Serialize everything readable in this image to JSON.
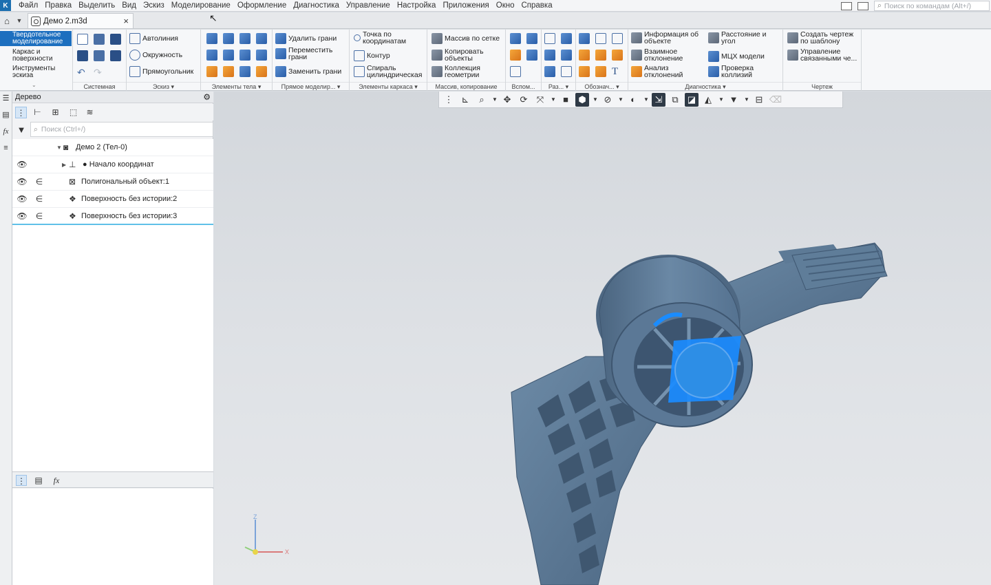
{
  "menubar": {
    "items": [
      "Файл",
      "Правка",
      "Выделить",
      "Вид",
      "Эскиз",
      "Моделирование",
      "Оформление",
      "Диагностика",
      "Управление",
      "Настройка",
      "Приложения",
      "Окно",
      "Справка"
    ],
    "search_placeholder": "Поиск по командам (Alt+/)"
  },
  "tabbar": {
    "doc_tab_label": "Демо 2.m3d",
    "close_glyph": "×"
  },
  "ribbon": {
    "modes": [
      "Твердотельное моделирование",
      "Каркас и поверхности",
      "Инструменты эскиза"
    ],
    "groups": {
      "system": "Системная",
      "sketch": "Эскиз",
      "body": "Элементы тела",
      "direct": "Прямое моделир...",
      "frame": "Элементы каркаса",
      "array": "Массив, копирование",
      "aux": "Вспом...",
      "size": "Раз...",
      "notation": "Обознач...",
      "diagnostics": "Диагностика",
      "drawing": "Чертеж"
    },
    "sketch_buttons": [
      "Автолиния",
      "Окружность",
      "Прямоугольник"
    ],
    "direct_buttons": [
      "Удалить грани",
      "Переместить грани",
      "Заменить грани"
    ],
    "frame_buttons": [
      "Точка по координатам",
      "Контур",
      "Спираль цилиндрическая"
    ],
    "array_buttons": [
      "Массив по сетке",
      "Копировать объекты",
      "Коллекция геометрии"
    ],
    "diag_buttons": [
      "Информация об объекте",
      "Взаимное отклонение",
      "Анализ отклонений",
      "Расстояние и угол",
      "МЦХ модели",
      "Проверка коллизий"
    ],
    "drawing_buttons": [
      "Создать чертеж по шаблону",
      "Управление связанными че..."
    ]
  },
  "tree": {
    "header": "Дерево",
    "search_placeholder": "Поиск (Ctrl+/)",
    "rows": [
      {
        "label": "Демо 2 (Тел-0)",
        "icon": "part-icon"
      },
      {
        "label": "● Начало координат",
        "icon": "origin-icon"
      },
      {
        "label": "Полигональный объект:1",
        "icon": "mesh-icon"
      },
      {
        "label": "Поверхность без истории:2",
        "icon": "surface-icon"
      },
      {
        "label": "Поверхность без истории:3",
        "icon": "surface-icon"
      }
    ]
  },
  "triad": {
    "z": "Z",
    "x": "X"
  },
  "colors": {
    "accent": "#1d6fbf",
    "model": "#5a7894",
    "highlight": "#1a8cff"
  }
}
